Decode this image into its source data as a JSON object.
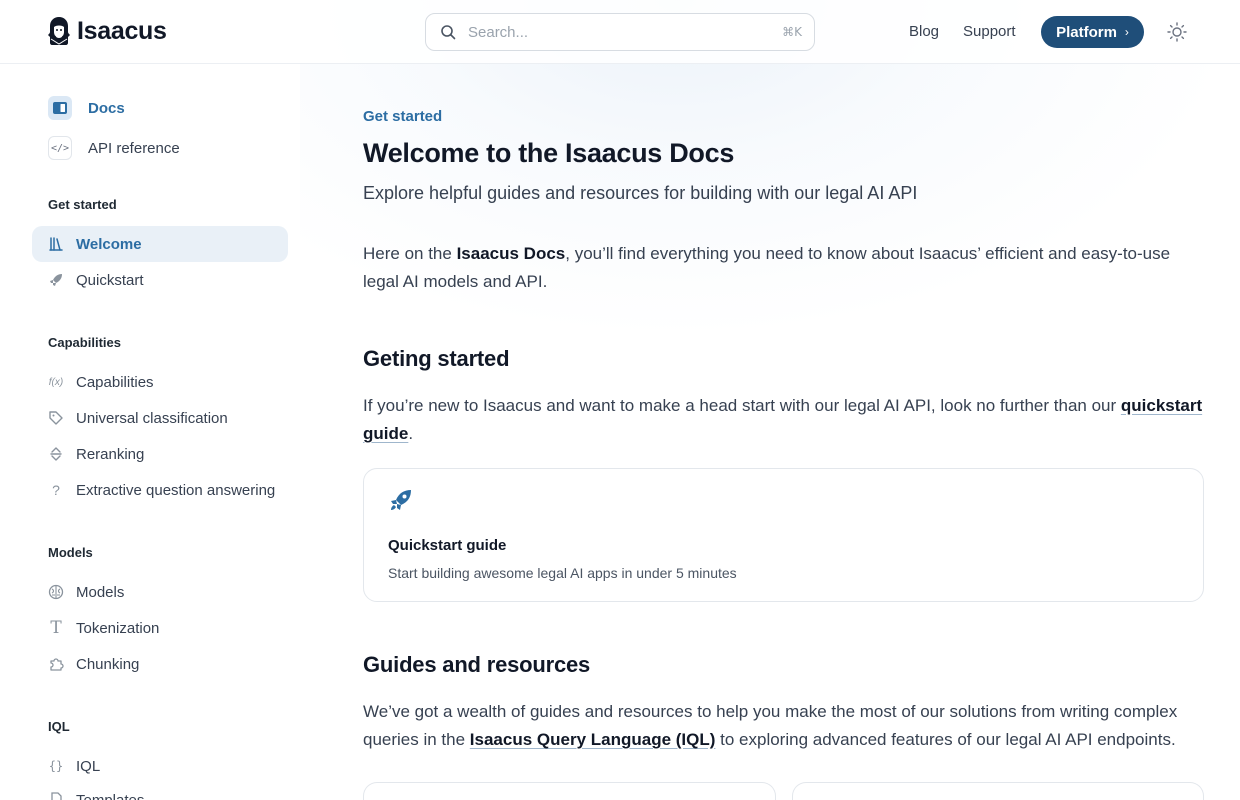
{
  "header": {
    "brand": "Isaacus",
    "search_placeholder": "Search...",
    "search_shortcut": "⌘K",
    "nav": {
      "blog": "Blog",
      "support": "Support"
    },
    "platform_label": "Platform",
    "platform_chevron": "›"
  },
  "sidebar": {
    "top_links": [
      {
        "label": "Docs",
        "icon": "book-icon"
      },
      {
        "label": "API reference",
        "icon": "code-icon",
        "glyph": "</>"
      }
    ],
    "sections": [
      {
        "title": "Get started",
        "items": [
          {
            "label": "Welcome",
            "icon": "library-icon",
            "active": true
          },
          {
            "label": "Quickstart",
            "icon": "rocket-icon"
          }
        ]
      },
      {
        "title": "Capabilities",
        "items": [
          {
            "label": "Capabilities",
            "icon": "function-icon",
            "glyph": "f(x)"
          },
          {
            "label": "Universal classification",
            "icon": "tag-icon"
          },
          {
            "label": "Reranking",
            "icon": "sort-icon"
          },
          {
            "label": "Extractive question answering",
            "icon": "question-icon",
            "glyph": "?"
          }
        ]
      },
      {
        "title": "Models",
        "items": [
          {
            "label": "Models",
            "icon": "brain-icon"
          },
          {
            "label": "Tokenization",
            "icon": "text-icon",
            "glyph": "T"
          },
          {
            "label": "Chunking",
            "icon": "puzzle-icon"
          }
        ]
      },
      {
        "title": "IQL",
        "items": [
          {
            "label": "IQL",
            "icon": "braces-icon",
            "glyph": "{}"
          },
          {
            "label": "Templates",
            "icon": "file-icon"
          }
        ]
      }
    ]
  },
  "main": {
    "eyebrow": "Get started",
    "title": "Welcome to the Isaacus Docs",
    "subtitle": "Explore helpful guides and resources for building with our legal AI API",
    "intro": {
      "before": "Here on the ",
      "bold": "Isaacus Docs",
      "after": ", you’ll find everything you need to know about Isaacus’ efficient and easy-to-use legal AI models and API."
    },
    "section1": {
      "heading": "Geting started",
      "text_before": "If you’re new to Isaacus and want to make a head start with our legal AI API, look no further than our ",
      "link": "quickstart guide",
      "text_after": "."
    },
    "card": {
      "title": "Quickstart guide",
      "description": "Start building awesome legal AI apps in under 5 minutes"
    },
    "section2": {
      "heading": "Guides and resources",
      "text_before": "We’ve got a wealth of guides and resources to help you make the most of our solutions from writing complex queries in the ",
      "link": "Isaacus Query Language (IQL)",
      "text_after": " to exploring advanced features of our legal AI API endpoints."
    }
  },
  "colors": {
    "accent": "#2c6da3",
    "platform_button": "#1f4e79",
    "active_bg": "#e9f0f7"
  }
}
